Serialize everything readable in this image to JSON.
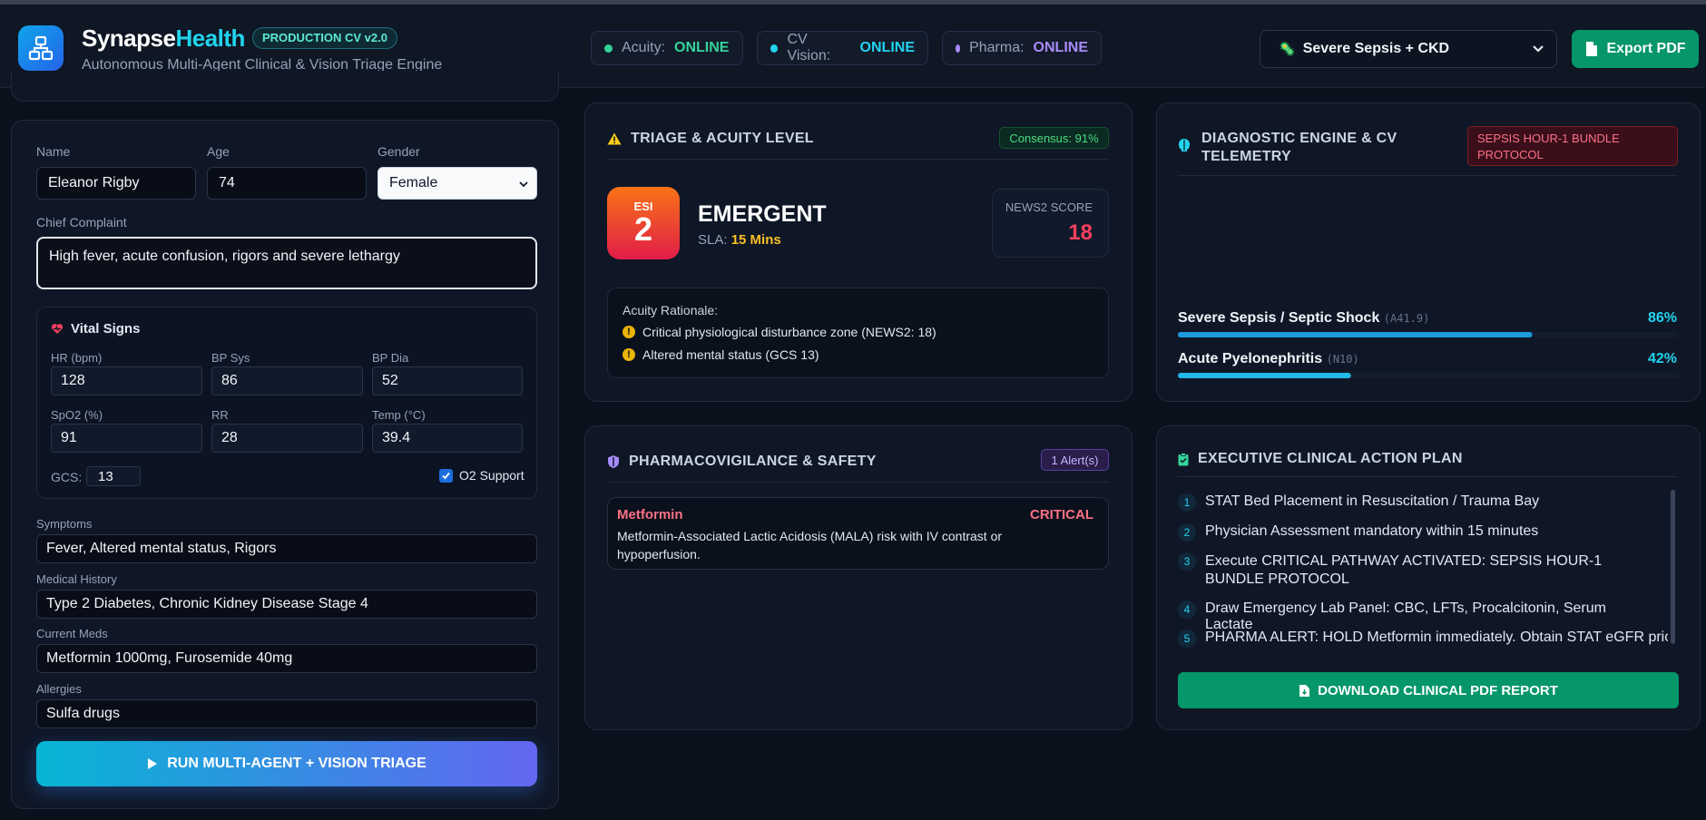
{
  "header": {
    "brand_main": "Synapse",
    "brand_accent": "Health",
    "version_badge": "PRODUCTION CV v2.0",
    "tagline": "Autonomous Multi-Agent Clinical & Vision Triage Engine",
    "status": [
      {
        "label": "Acuity:",
        "value": "ONLINE",
        "color": "#34d399"
      },
      {
        "label": "CV Vision:",
        "value": "ONLINE",
        "color": "#22d3ee"
      },
      {
        "label": "Pharma:",
        "value": "ONLINE",
        "color": "#a78bfa"
      }
    ],
    "scenario_select": "Severe Sepsis + CKD",
    "export_label": "Export PDF"
  },
  "patient": {
    "name_label": "Name",
    "name": "Eleanor Rigby",
    "age_label": "Age",
    "age": "74",
    "gender_label": "Gender",
    "gender": "Female",
    "complaint_label": "Chief Complaint",
    "complaint": "High fever, acute confusion, rigors and severe lethargy",
    "vitals_title": "Vital Signs",
    "vitals": {
      "hr_label": "HR (bpm)",
      "hr": "128",
      "bpsys_label": "BP Sys",
      "bpsys": "86",
      "bpdia_label": "BP Dia",
      "bpdia": "52",
      "spo2_label": "SpO2 (%)",
      "spo2": "91",
      "rr_label": "RR",
      "rr": "28",
      "temp_label": "Temp (°C)",
      "temp": "39.4",
      "gcs_label": "GCS:",
      "gcs": "13",
      "o2_label": "O2 Support",
      "o2_checked": true
    },
    "symptoms_label": "Symptoms",
    "symptoms": "Fever, Altered mental status, Rigors",
    "history_label": "Medical History",
    "history": "Type 2 Diabetes, Chronic Kidney Disease Stage 4",
    "meds_label": "Current Meds",
    "meds": "Metformin 1000mg, Furosemide 40mg",
    "allergies_label": "Allergies",
    "allergies": "Sulfa drugs",
    "run_label": "RUN MULTI-AGENT + VISION TRIAGE"
  },
  "triage": {
    "title": "TRIAGE & ACUITY LEVEL",
    "consensus": "Consensus: 91%",
    "esi_label": "ESI",
    "esi_level": "2",
    "acuity": "EMERGENT",
    "sla_label": "SLA:",
    "sla_value": "15 Mins",
    "news2_label": "NEWS2 SCORE",
    "news2_value": "18",
    "rationale_title": "Acuity Rationale:",
    "rationale": [
      "Critical physiological disturbance zone (NEWS2: 18)",
      "Altered mental status (GCS 13)"
    ]
  },
  "diagnostic": {
    "title": "DIAGNOSTIC ENGINE & CV TELEMETRY",
    "protocol_badge": "SEPSIS HOUR-1 BUNDLE PROTOCOL",
    "diagnoses": [
      {
        "name": "Severe Sepsis / Septic Shock",
        "code": "(A41.9)",
        "pct": "86%",
        "value": 0.86
      },
      {
        "name": "Acute Pyelonephritis",
        "code": "(N10)",
        "pct": "42%",
        "value": 0.42
      }
    ]
  },
  "pharma": {
    "title": "PHARMACOVIGILANCE & SAFETY",
    "alerts_badge": "1 Alert(s)",
    "alert_drug": "Metformin",
    "alert_level": "CRITICAL",
    "alert_text": "Metformin-Associated Lactic Acidosis (MALA) risk with IV contrast or hypoperfusion."
  },
  "plan": {
    "title": "EXECUTIVE CLINICAL ACTION PLAN",
    "items": [
      {
        "num": "1",
        "text": "STAT Bed Placement in Resuscitation / Trauma Bay"
      },
      {
        "num": "2",
        "text": "Physician Assessment mandatory within 15 minutes"
      },
      {
        "num": "3",
        "text": "Execute CRITICAL PATHWAY ACTIVATED: SEPSIS HOUR-1 BUNDLE PROTOCOL"
      },
      {
        "num": "4",
        "text": "Draw Emergency Lab Panel: CBC, LFTs, Procalcitonin, Serum Lactate"
      },
      {
        "num": "5",
        "text": "PHARMA ALERT: HOLD Metformin immediately. Obtain STAT eGFR prior"
      }
    ],
    "download_label": "DOWNLOAD CLINICAL PDF REPORT"
  }
}
